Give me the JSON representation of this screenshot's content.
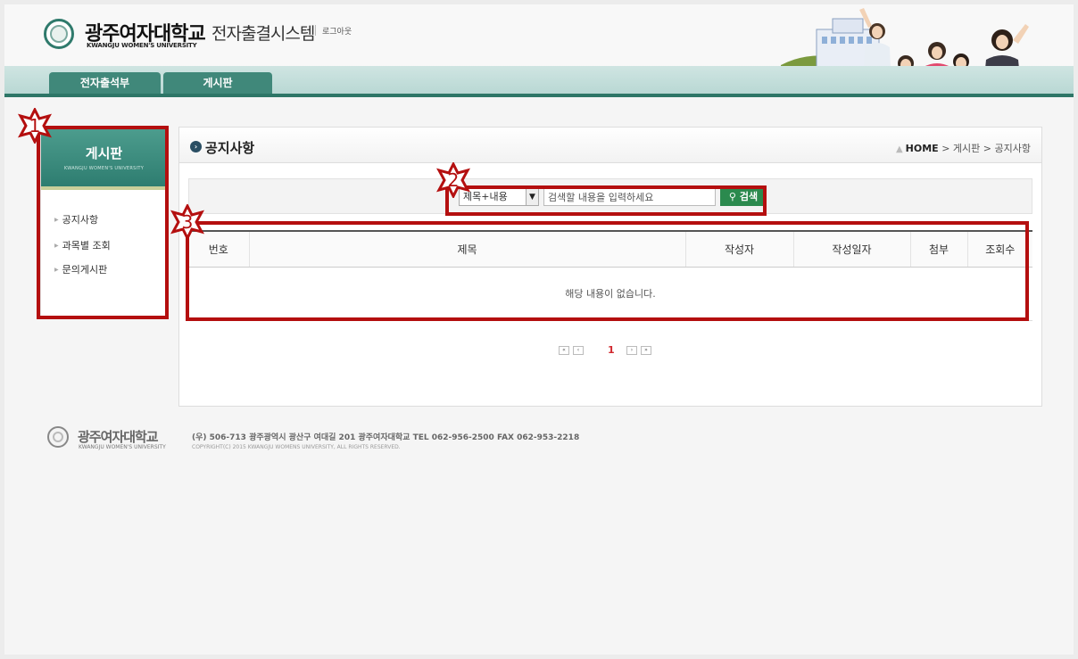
{
  "header": {
    "logo_kr": "광주여자대학교",
    "logo_en": "KWANGJU WOMEN'S UNIVERSITY",
    "system_title": "전자출결시스템",
    "logout": "로그아웃"
  },
  "nav": {
    "tabs": [
      {
        "label": "전자출석부"
      },
      {
        "label": "게시판"
      }
    ]
  },
  "sidebar": {
    "title": "게시판",
    "subtitle": "KWANGJU WOMEN'S UNIVERSITY",
    "items": [
      {
        "label": "공지사항"
      },
      {
        "label": "과목별 조회"
      },
      {
        "label": "문의게시판"
      }
    ]
  },
  "main": {
    "title": "공지사항",
    "breadcrumb": {
      "home": "HOME",
      "sep": ">",
      "level1": "게시판",
      "level2": "공지사항"
    },
    "search": {
      "select_value": "제목+내용",
      "placeholder": "검색할 내용을 입력하세요",
      "button": "검색"
    },
    "table": {
      "columns": [
        "번호",
        "제목",
        "작성자",
        "작성일자",
        "첨부",
        "조회수"
      ],
      "empty_message": "해당 내용이 없습니다."
    },
    "pagination": {
      "current": "1"
    }
  },
  "footer": {
    "logo_kr": "광주여자대학교",
    "logo_en": "KWANGJU WOMEN'S UNIVERSITY",
    "address": "(우) 506-713 광주광역시 광산구 여대길 201 광주여자대학교   TEL 062-956-2500   FAX 062-953-2218",
    "copyright": "COPYRIGHT(C) 2015 KWANGJU WOMENS UNIVERSITY, ALL RIGHTS RESERVED."
  },
  "annotations": {
    "marker1": "1",
    "marker2": "2",
    "marker3": "3",
    "color": "#b40f0f"
  },
  "colors": {
    "brand_green": "#2d7667",
    "search_button": "#2b8a4e",
    "pager_current": "#d1282e"
  }
}
